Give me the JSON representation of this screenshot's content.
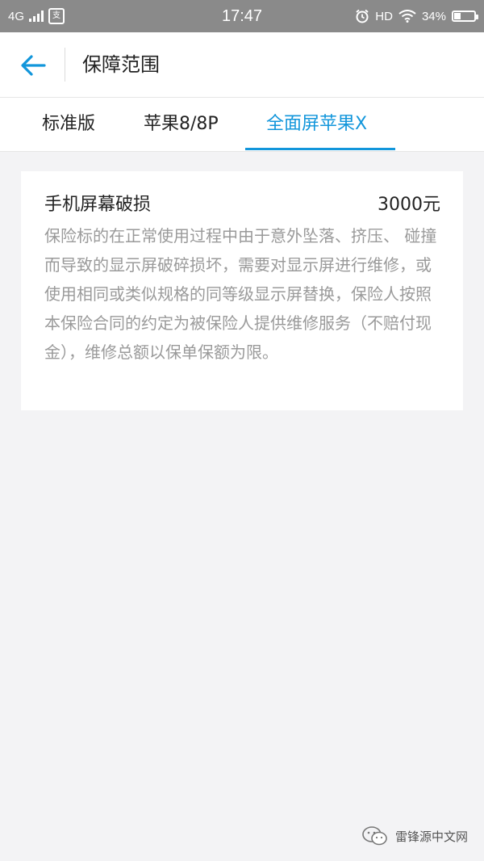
{
  "status_bar": {
    "network": "4G",
    "app_badge": "支",
    "time": "17:47",
    "hd": "HD",
    "battery": "34%",
    "battery_level": 0.34
  },
  "header": {
    "back_icon": "arrow-left-icon",
    "title": "保障范围"
  },
  "tabs": [
    {
      "label": "标准版",
      "active": false
    },
    {
      "label": "苹果8/8P",
      "active": false
    },
    {
      "label": "全面屏苹果X",
      "active": true
    }
  ],
  "coverage": {
    "title": "手机屏幕破损",
    "amount": "3000元",
    "description": "保险标的在正常使用过程中由于意外坠落、挤压、 碰撞而导致的显示屏破碎损坏，需要对显示屏进行维修，或使用相同或类似规格的同等级显示屏替换，保险人按照本保险合同的约定为被保险人提供维修服务（不赔付现金），维修总额以保单保额为限。"
  },
  "watermark": {
    "text": "雷锋源中文网",
    "icon": "wechat-icon"
  },
  "colors": {
    "accent": "#1296db",
    "status_bar": "#8a8a8a",
    "background": "#f3f3f5"
  }
}
